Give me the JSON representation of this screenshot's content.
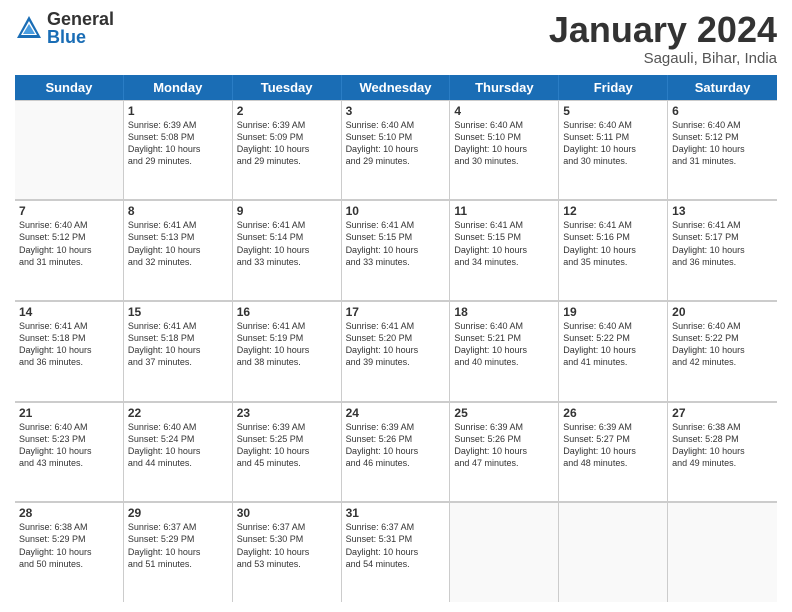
{
  "logo": {
    "general": "General",
    "blue": "Blue"
  },
  "title": "January 2024",
  "subtitle": "Sagauli, Bihar, India",
  "days": [
    "Sunday",
    "Monday",
    "Tuesday",
    "Wednesday",
    "Thursday",
    "Friday",
    "Saturday"
  ],
  "weeks": [
    [
      {
        "day": null,
        "data": null
      },
      {
        "day": "1",
        "data": "Sunrise: 6:39 AM\nSunset: 5:08 PM\nDaylight: 10 hours\nand 29 minutes."
      },
      {
        "day": "2",
        "data": "Sunrise: 6:39 AM\nSunset: 5:09 PM\nDaylight: 10 hours\nand 29 minutes."
      },
      {
        "day": "3",
        "data": "Sunrise: 6:40 AM\nSunset: 5:10 PM\nDaylight: 10 hours\nand 29 minutes."
      },
      {
        "day": "4",
        "data": "Sunrise: 6:40 AM\nSunset: 5:10 PM\nDaylight: 10 hours\nand 30 minutes."
      },
      {
        "day": "5",
        "data": "Sunrise: 6:40 AM\nSunset: 5:11 PM\nDaylight: 10 hours\nand 30 minutes."
      },
      {
        "day": "6",
        "data": "Sunrise: 6:40 AM\nSunset: 5:12 PM\nDaylight: 10 hours\nand 31 minutes."
      }
    ],
    [
      {
        "day": "7",
        "data": "Sunrise: 6:40 AM\nSunset: 5:12 PM\nDaylight: 10 hours\nand 31 minutes."
      },
      {
        "day": "8",
        "data": "Sunrise: 6:41 AM\nSunset: 5:13 PM\nDaylight: 10 hours\nand 32 minutes."
      },
      {
        "day": "9",
        "data": "Sunrise: 6:41 AM\nSunset: 5:14 PM\nDaylight: 10 hours\nand 33 minutes."
      },
      {
        "day": "10",
        "data": "Sunrise: 6:41 AM\nSunset: 5:15 PM\nDaylight: 10 hours\nand 33 minutes."
      },
      {
        "day": "11",
        "data": "Sunrise: 6:41 AM\nSunset: 5:15 PM\nDaylight: 10 hours\nand 34 minutes."
      },
      {
        "day": "12",
        "data": "Sunrise: 6:41 AM\nSunset: 5:16 PM\nDaylight: 10 hours\nand 35 minutes."
      },
      {
        "day": "13",
        "data": "Sunrise: 6:41 AM\nSunset: 5:17 PM\nDaylight: 10 hours\nand 36 minutes."
      }
    ],
    [
      {
        "day": "14",
        "data": "Sunrise: 6:41 AM\nSunset: 5:18 PM\nDaylight: 10 hours\nand 36 minutes."
      },
      {
        "day": "15",
        "data": "Sunrise: 6:41 AM\nSunset: 5:18 PM\nDaylight: 10 hours\nand 37 minutes."
      },
      {
        "day": "16",
        "data": "Sunrise: 6:41 AM\nSunset: 5:19 PM\nDaylight: 10 hours\nand 38 minutes."
      },
      {
        "day": "17",
        "data": "Sunrise: 6:41 AM\nSunset: 5:20 PM\nDaylight: 10 hours\nand 39 minutes."
      },
      {
        "day": "18",
        "data": "Sunrise: 6:40 AM\nSunset: 5:21 PM\nDaylight: 10 hours\nand 40 minutes."
      },
      {
        "day": "19",
        "data": "Sunrise: 6:40 AM\nSunset: 5:22 PM\nDaylight: 10 hours\nand 41 minutes."
      },
      {
        "day": "20",
        "data": "Sunrise: 6:40 AM\nSunset: 5:22 PM\nDaylight: 10 hours\nand 42 minutes."
      }
    ],
    [
      {
        "day": "21",
        "data": "Sunrise: 6:40 AM\nSunset: 5:23 PM\nDaylight: 10 hours\nand 43 minutes."
      },
      {
        "day": "22",
        "data": "Sunrise: 6:40 AM\nSunset: 5:24 PM\nDaylight: 10 hours\nand 44 minutes."
      },
      {
        "day": "23",
        "data": "Sunrise: 6:39 AM\nSunset: 5:25 PM\nDaylight: 10 hours\nand 45 minutes."
      },
      {
        "day": "24",
        "data": "Sunrise: 6:39 AM\nSunset: 5:26 PM\nDaylight: 10 hours\nand 46 minutes."
      },
      {
        "day": "25",
        "data": "Sunrise: 6:39 AM\nSunset: 5:26 PM\nDaylight: 10 hours\nand 47 minutes."
      },
      {
        "day": "26",
        "data": "Sunrise: 6:39 AM\nSunset: 5:27 PM\nDaylight: 10 hours\nand 48 minutes."
      },
      {
        "day": "27",
        "data": "Sunrise: 6:38 AM\nSunset: 5:28 PM\nDaylight: 10 hours\nand 49 minutes."
      }
    ],
    [
      {
        "day": "28",
        "data": "Sunrise: 6:38 AM\nSunset: 5:29 PM\nDaylight: 10 hours\nand 50 minutes."
      },
      {
        "day": "29",
        "data": "Sunrise: 6:37 AM\nSunset: 5:29 PM\nDaylight: 10 hours\nand 51 minutes."
      },
      {
        "day": "30",
        "data": "Sunrise: 6:37 AM\nSunset: 5:30 PM\nDaylight: 10 hours\nand 53 minutes."
      },
      {
        "day": "31",
        "data": "Sunrise: 6:37 AM\nSunset: 5:31 PM\nDaylight: 10 hours\nand 54 minutes."
      },
      {
        "day": null,
        "data": null
      },
      {
        "day": null,
        "data": null
      },
      {
        "day": null,
        "data": null
      }
    ]
  ]
}
